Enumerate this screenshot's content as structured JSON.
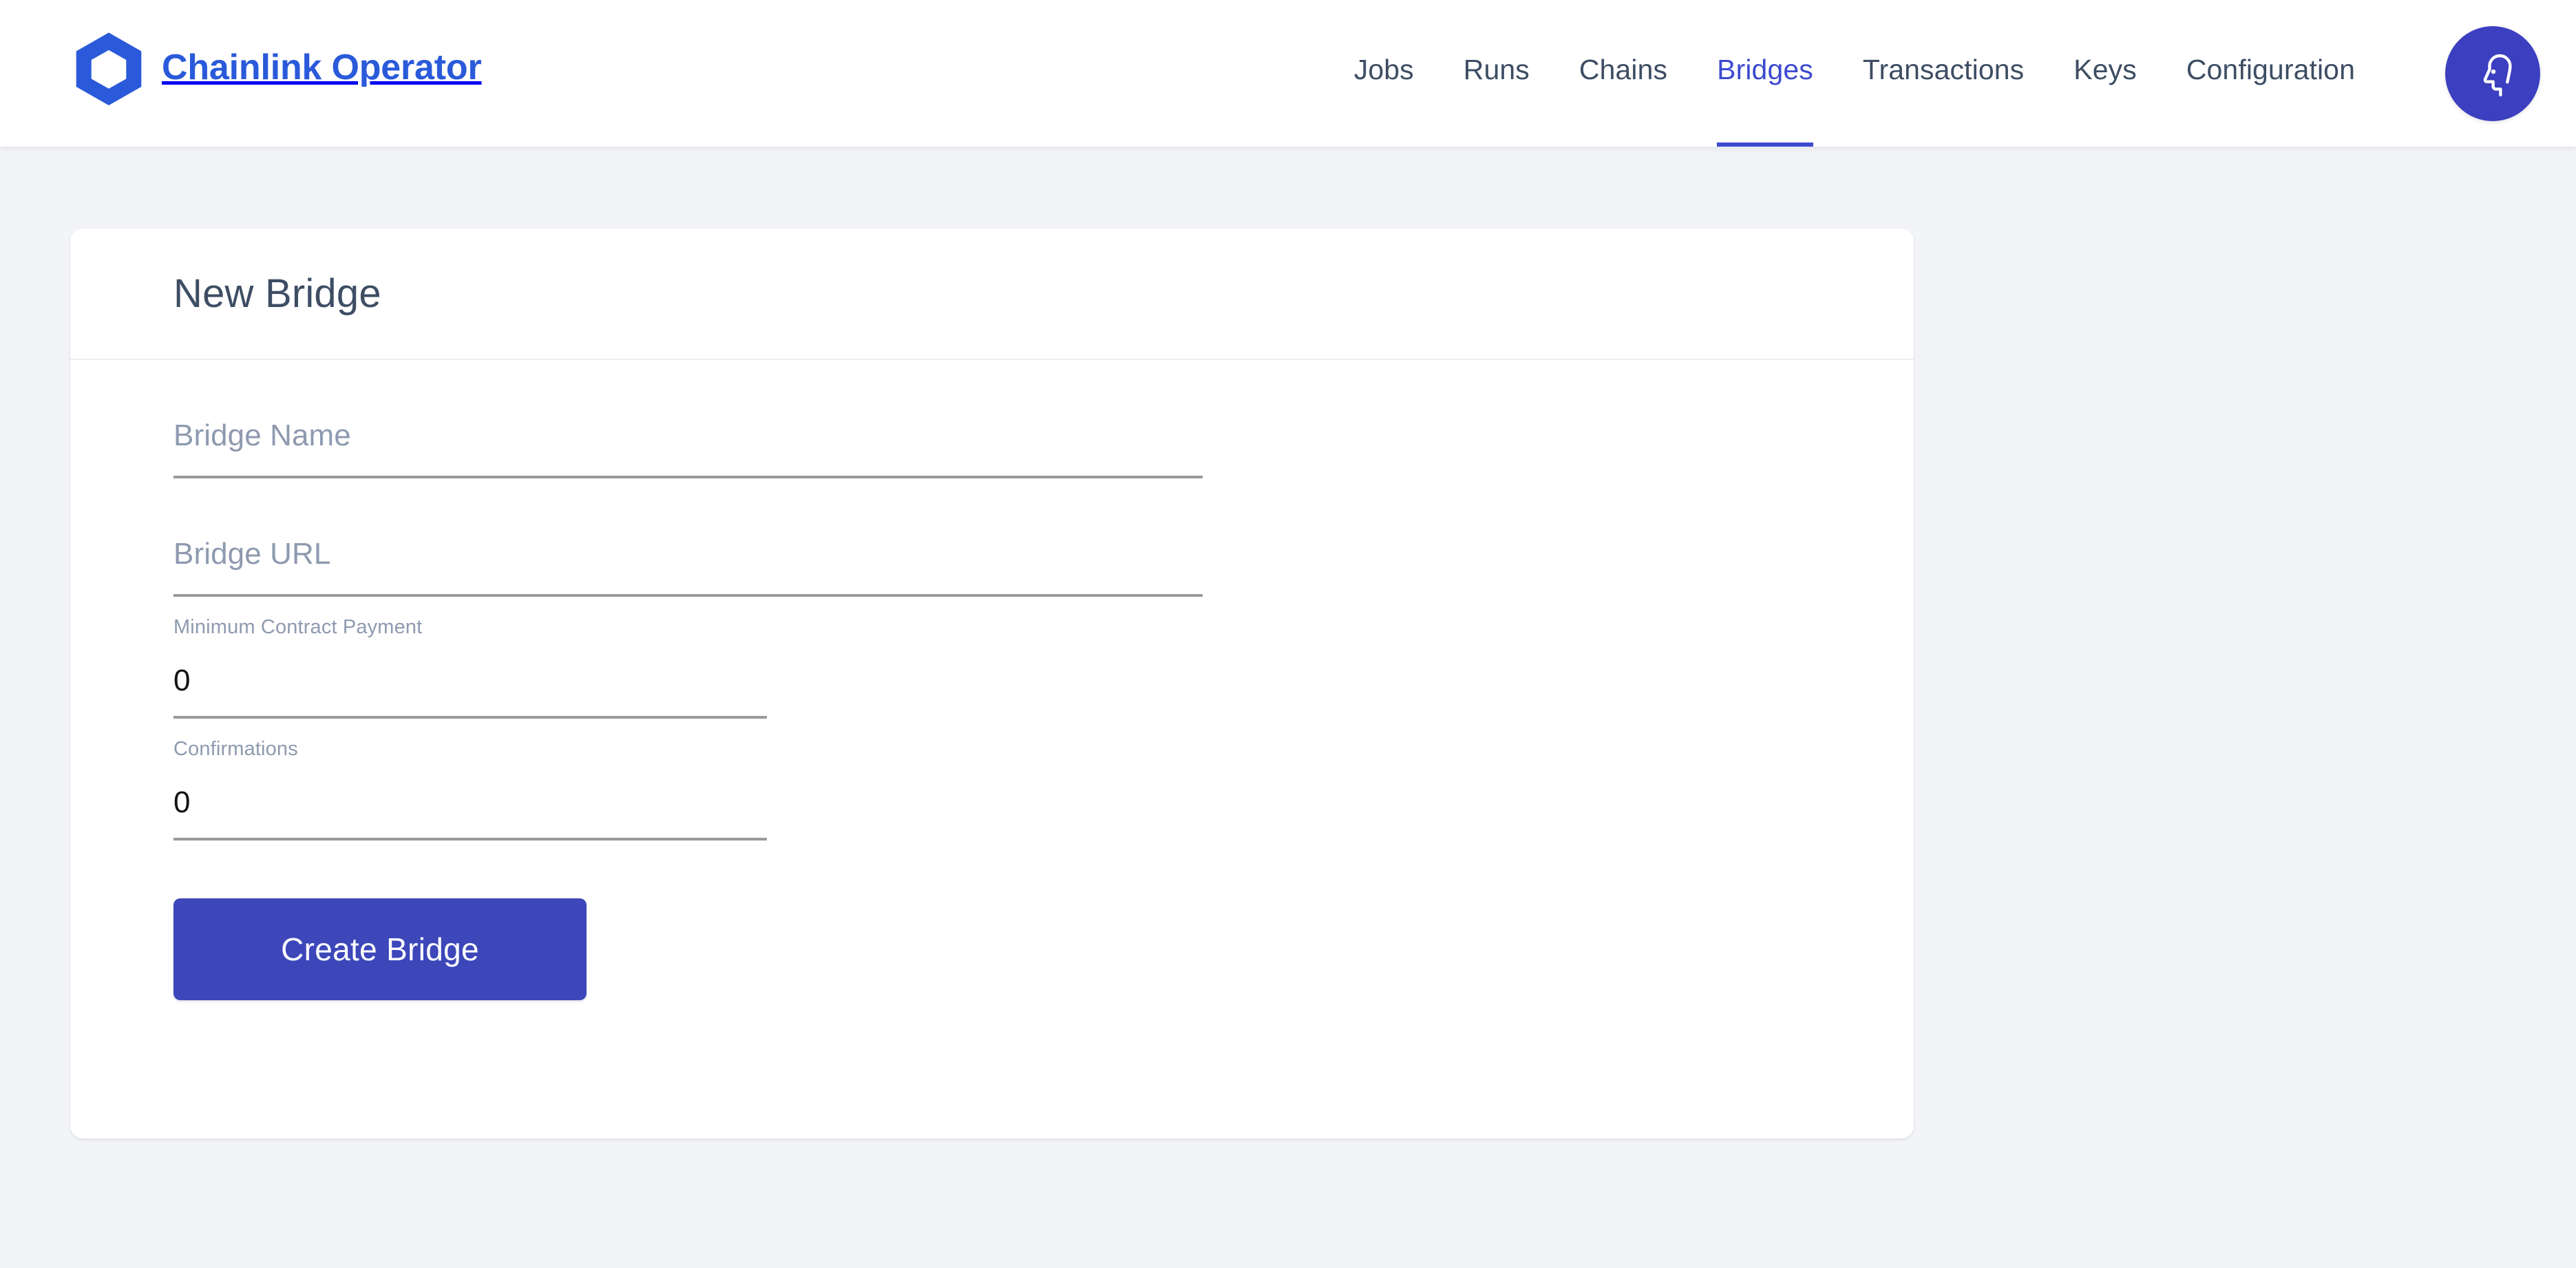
{
  "header": {
    "brand": {
      "logo_icon": "chainlink-hexagon-icon",
      "title": "Chainlink Operator",
      "logo_color": "#2a5ada"
    },
    "nav": {
      "items": [
        {
          "label": "Jobs",
          "active": false
        },
        {
          "label": "Runs",
          "active": false
        },
        {
          "label": "Chains",
          "active": false
        },
        {
          "label": "Bridges",
          "active": true
        },
        {
          "label": "Transactions",
          "active": false
        },
        {
          "label": "Keys",
          "active": false
        },
        {
          "label": "Configuration",
          "active": false
        }
      ],
      "active_color": "#3c4ad0",
      "inactive_color": "#3d4d63"
    },
    "account": {
      "icon": "head-profile-icon",
      "background_color": "#3c3fc0"
    }
  },
  "card": {
    "title": "New Bridge",
    "form": {
      "fields": [
        {
          "name": "bridge_name",
          "placeholder": "Bridge Name",
          "value": "",
          "type": "text"
        },
        {
          "name": "bridge_url",
          "placeholder": "Bridge URL",
          "value": "",
          "type": "text"
        },
        {
          "name": "minimum_contract_payment",
          "label": "Minimum Contract Payment",
          "value": "0",
          "type": "number"
        },
        {
          "name": "confirmations",
          "label": "Confirmations",
          "value": "0",
          "type": "number"
        }
      ],
      "submit_label": "Create Bridge",
      "submit_color": "#3d47ba"
    }
  },
  "page": {
    "background_color": "#f3f4f7"
  }
}
